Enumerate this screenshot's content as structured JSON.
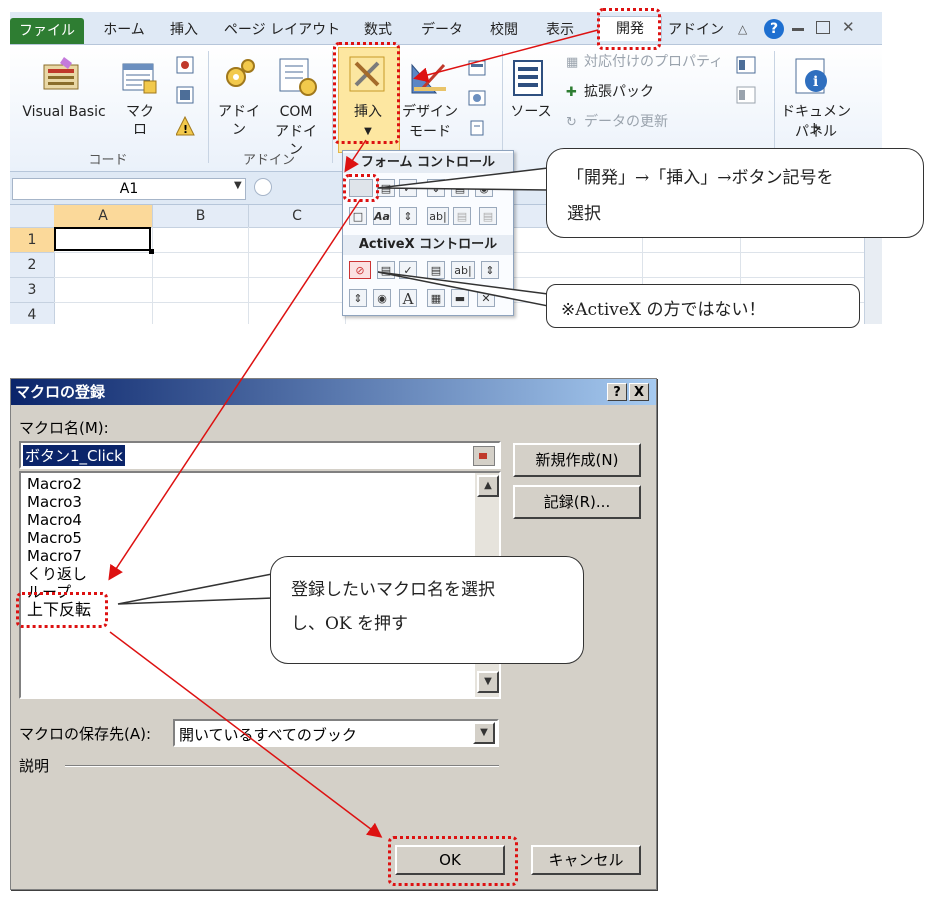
{
  "excel": {
    "tabs": [
      {
        "label": "ファイル"
      },
      {
        "label": "ホーム"
      },
      {
        "label": "挿入"
      },
      {
        "label": "ページ レイアウト"
      },
      {
        "label": "数式"
      },
      {
        "label": "データ"
      },
      {
        "label": "校閲"
      },
      {
        "label": "表示"
      },
      {
        "label": "開発"
      },
      {
        "label": "アドイン"
      }
    ],
    "ribbon": {
      "visual_basic": "Visual Basic",
      "macro": "マクロ",
      "group_code": "コード",
      "addin": "アドイン",
      "com_addin_1": "COM",
      "com_addin_2": "アドイン",
      "group_addin": "アドイン",
      "insert": "挿入",
      "design_mode_1": "デザイン",
      "design_mode_2": "モード",
      "source": "ソース",
      "mapping_props": "対応付けのプロパティ",
      "expansion_packs": "拡張パック",
      "refresh_data": "データの更新",
      "doc_panel_1": "ドキュメント",
      "doc_panel_2": "パネル"
    },
    "namebox": "A1",
    "columns": [
      "A",
      "B",
      "C"
    ],
    "rows": [
      "1",
      "2",
      "3",
      "4"
    ],
    "panel": {
      "form_controls": "フォーム コントロール",
      "activex_controls": "ActiveX コントロール"
    }
  },
  "callouts": {
    "c1_line1": "「開発」→「挿入」→ボタン記号を",
    "c1_line2": "選択",
    "c2": "※ActiveX の方ではない！",
    "c3_line1": "登録したいマクロ名を選択",
    "c3_line2": "し、OK を押す"
  },
  "dialog": {
    "title": "マクロの登録",
    "help_btn": "?",
    "close_btn": "X",
    "macro_name_label": "マクロ名(M):",
    "macro_name_value": "ボタン1_Click",
    "macros": [
      "Macro2",
      "Macro3",
      "Macro4",
      "Macro5",
      "Macro7",
      "くり返し",
      "ループ",
      "上下反転"
    ],
    "new_button": "新規作成(N)",
    "record_button": "記録(R)...",
    "store_label": "マクロの保存先(A):",
    "store_value": "開いているすべてのブック",
    "description_label": "説明",
    "ok_button": "OK",
    "cancel_button": "キャンセル"
  },
  "colors": {
    "highlight": "#dd1111",
    "file_tab": "#2e7d32",
    "titlebar": "#0a246a"
  }
}
